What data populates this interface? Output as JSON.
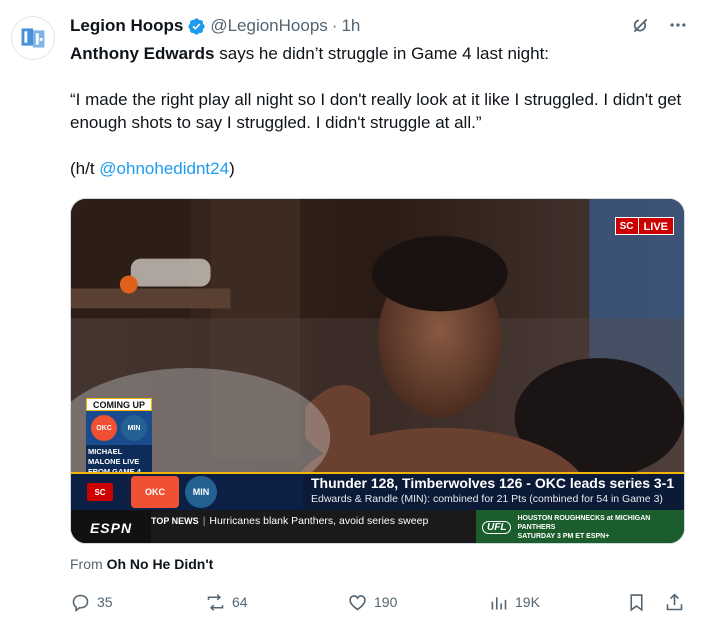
{
  "author": {
    "name": "Legion Hoops",
    "handle": "@LegionHoops",
    "separator": "·",
    "time": "1h",
    "avatar_icon": "legion-hoops-logo",
    "verified_icon": "verified-badge-icon",
    "verified_color": "#1d9bf0"
  },
  "tweet": {
    "subject": "Anthony Edwards",
    "line1_rest": " says he didn’t struggle in Game 4 last night:",
    "quote": "“I made the right play all night so I don't really look at it like I struggled. I didn't get enough shots to say I struggled. I didn't struggle at all.”",
    "hat_tip_prefix": "(h/t ",
    "hat_tip_link": "@ohnohedidnt24",
    "hat_tip_suffix": ")",
    "link_color": "#1d9bf0"
  },
  "media": {
    "live_badge": {
      "network": "SC",
      "label": "LIVE"
    },
    "coming_up": {
      "label": "COMING UP",
      "team1": "OKC",
      "team2": "MIN",
      "caption": "MICHAEL MALONE LIVE FROM GAME 4"
    },
    "score_strip": {
      "headline": "Thunder 128, Timberwolves 126 - OKC leads series 3-1",
      "subline": "Edwards & Randle (MIN): combined for 21 Pts (combined for 54 in Game 3)",
      "team1": "OKC",
      "team2": "MIN",
      "network": "SC"
    },
    "ticker": {
      "brand": "ESPN",
      "top_news_label": "TOP NEWS",
      "separator": "|",
      "news": "Hurricanes blank Panthers, avoid series sweep",
      "ufl_logo": "UFL",
      "ufl_line1": "HOUSTON ROUGHNECKS at MICHIGAN PANTHERS",
      "ufl_line2": "SATURDAY 3 PM ET ESPN+"
    }
  },
  "source": {
    "prefix": "From ",
    "name": "Oh No He Didn't"
  },
  "actions": {
    "replies": "35",
    "reposts": "64",
    "likes": "190",
    "views": "19K"
  },
  "icons": {
    "grok": "grok-icon",
    "more": "more-icon",
    "reply": "reply-icon",
    "repost": "repost-icon",
    "like": "like-icon",
    "views": "views-icon",
    "bookmark": "bookmark-icon",
    "share": "share-icon"
  }
}
